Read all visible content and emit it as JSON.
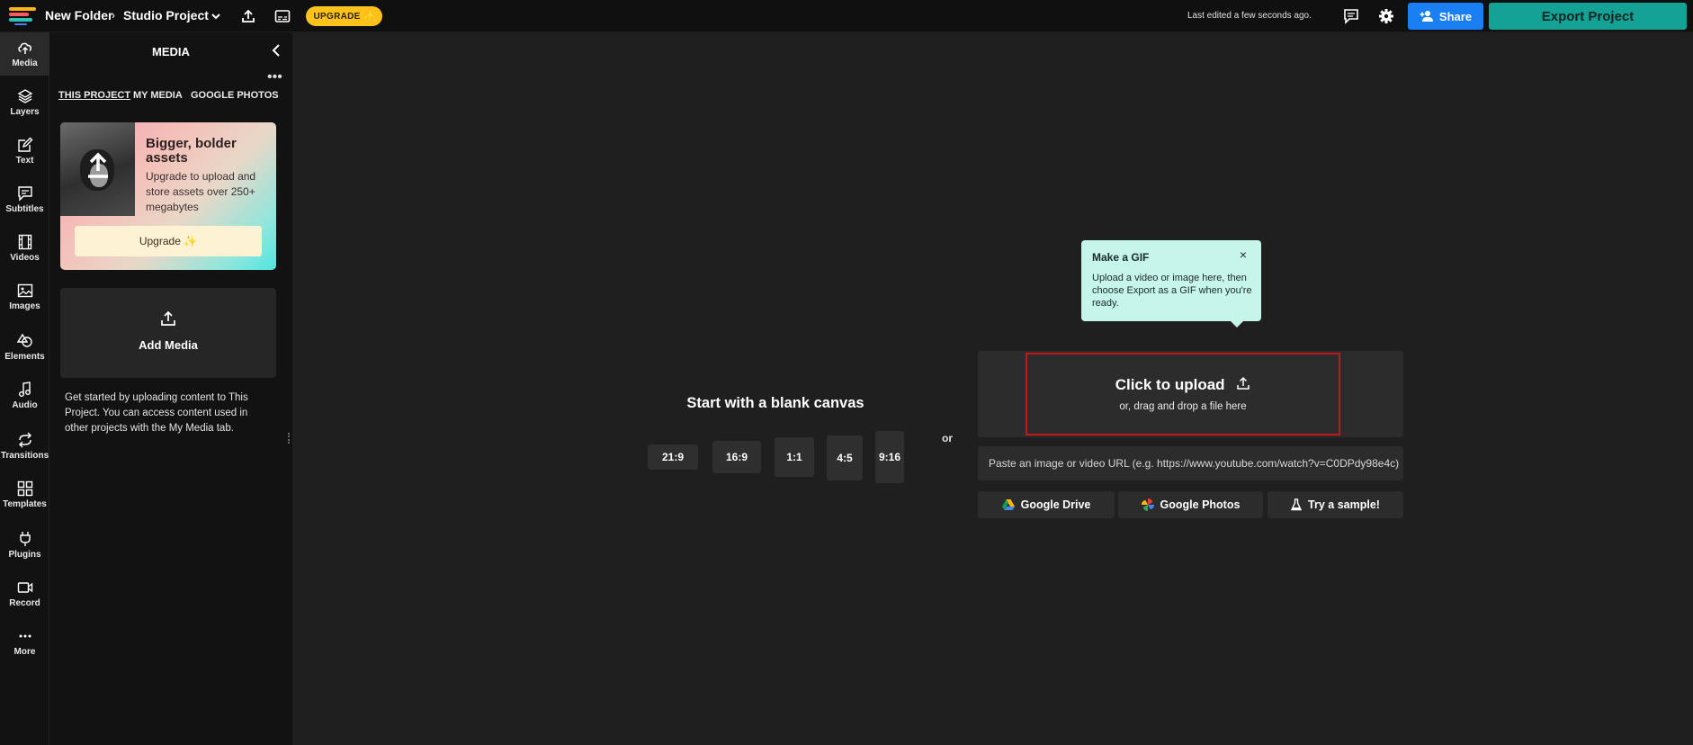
{
  "header": {
    "folder": "New Folder",
    "crumb_separator": "›",
    "project": "Studio Project",
    "upgrade": "UPGRADE ✨",
    "last_edited": "Last edited a few seconds ago.",
    "share": "Share",
    "export": "Export Project"
  },
  "rail": {
    "items": [
      {
        "label": "Media",
        "icon": "upload-cloud-icon",
        "active": true
      },
      {
        "label": "Layers",
        "icon": "layers-icon"
      },
      {
        "label": "Text",
        "icon": "text-edit-icon"
      },
      {
        "label": "Subtitles",
        "icon": "subtitles-icon"
      },
      {
        "label": "Videos",
        "icon": "film-icon"
      },
      {
        "label": "Images",
        "icon": "image-icon"
      },
      {
        "label": "Elements",
        "icon": "shapes-icon"
      },
      {
        "label": "Audio",
        "icon": "music-note-icon"
      },
      {
        "label": "Transitions",
        "icon": "transition-icon"
      },
      {
        "label": "Templates",
        "icon": "grid-icon"
      },
      {
        "label": "Plugins",
        "icon": "plug-icon"
      },
      {
        "label": "Record",
        "icon": "record-camera-icon"
      },
      {
        "label": "More",
        "icon": "more-dots-icon"
      }
    ]
  },
  "panel": {
    "title": "MEDIA",
    "tabs": [
      "THIS PROJECT",
      "MY MEDIA",
      "GOOGLE PHOTOS"
    ],
    "more": "•••",
    "promo": {
      "title": "Bigger, bolder assets",
      "description": "Upgrade to upload and store assets over 250+ megabytes",
      "button": "Upgrade ✨"
    },
    "add_media": "Add Media",
    "help": "Get started by uploading content to This Project. You can access content used in other projects with the My Media tab."
  },
  "canvas": {
    "blank_title": "Start with a blank canvas",
    "ratios": [
      "21:9",
      "16:9",
      "1:1",
      "4:5",
      "9:16"
    ],
    "or": "or",
    "tooltip": {
      "title": "Make a GIF",
      "close": "×",
      "body": "Upload a video or image here, then choose Export as a GIF when you're ready."
    },
    "upload": {
      "title": "Click to upload",
      "subtitle": "or, drag and drop a file here"
    },
    "url_placeholder": "Paste an image or video URL (e.g. https://www.youtube.com/watch?v=C0DPdy98e4c)",
    "sources": [
      "Google Drive",
      "Google Photos",
      "Try a sample!"
    ]
  },
  "colors": {
    "share": "#1a7ff2",
    "export": "#14a294",
    "upgrade": "#ffc21a",
    "highlight": "#c4161c",
    "tooltip": "#c6f5ea"
  }
}
